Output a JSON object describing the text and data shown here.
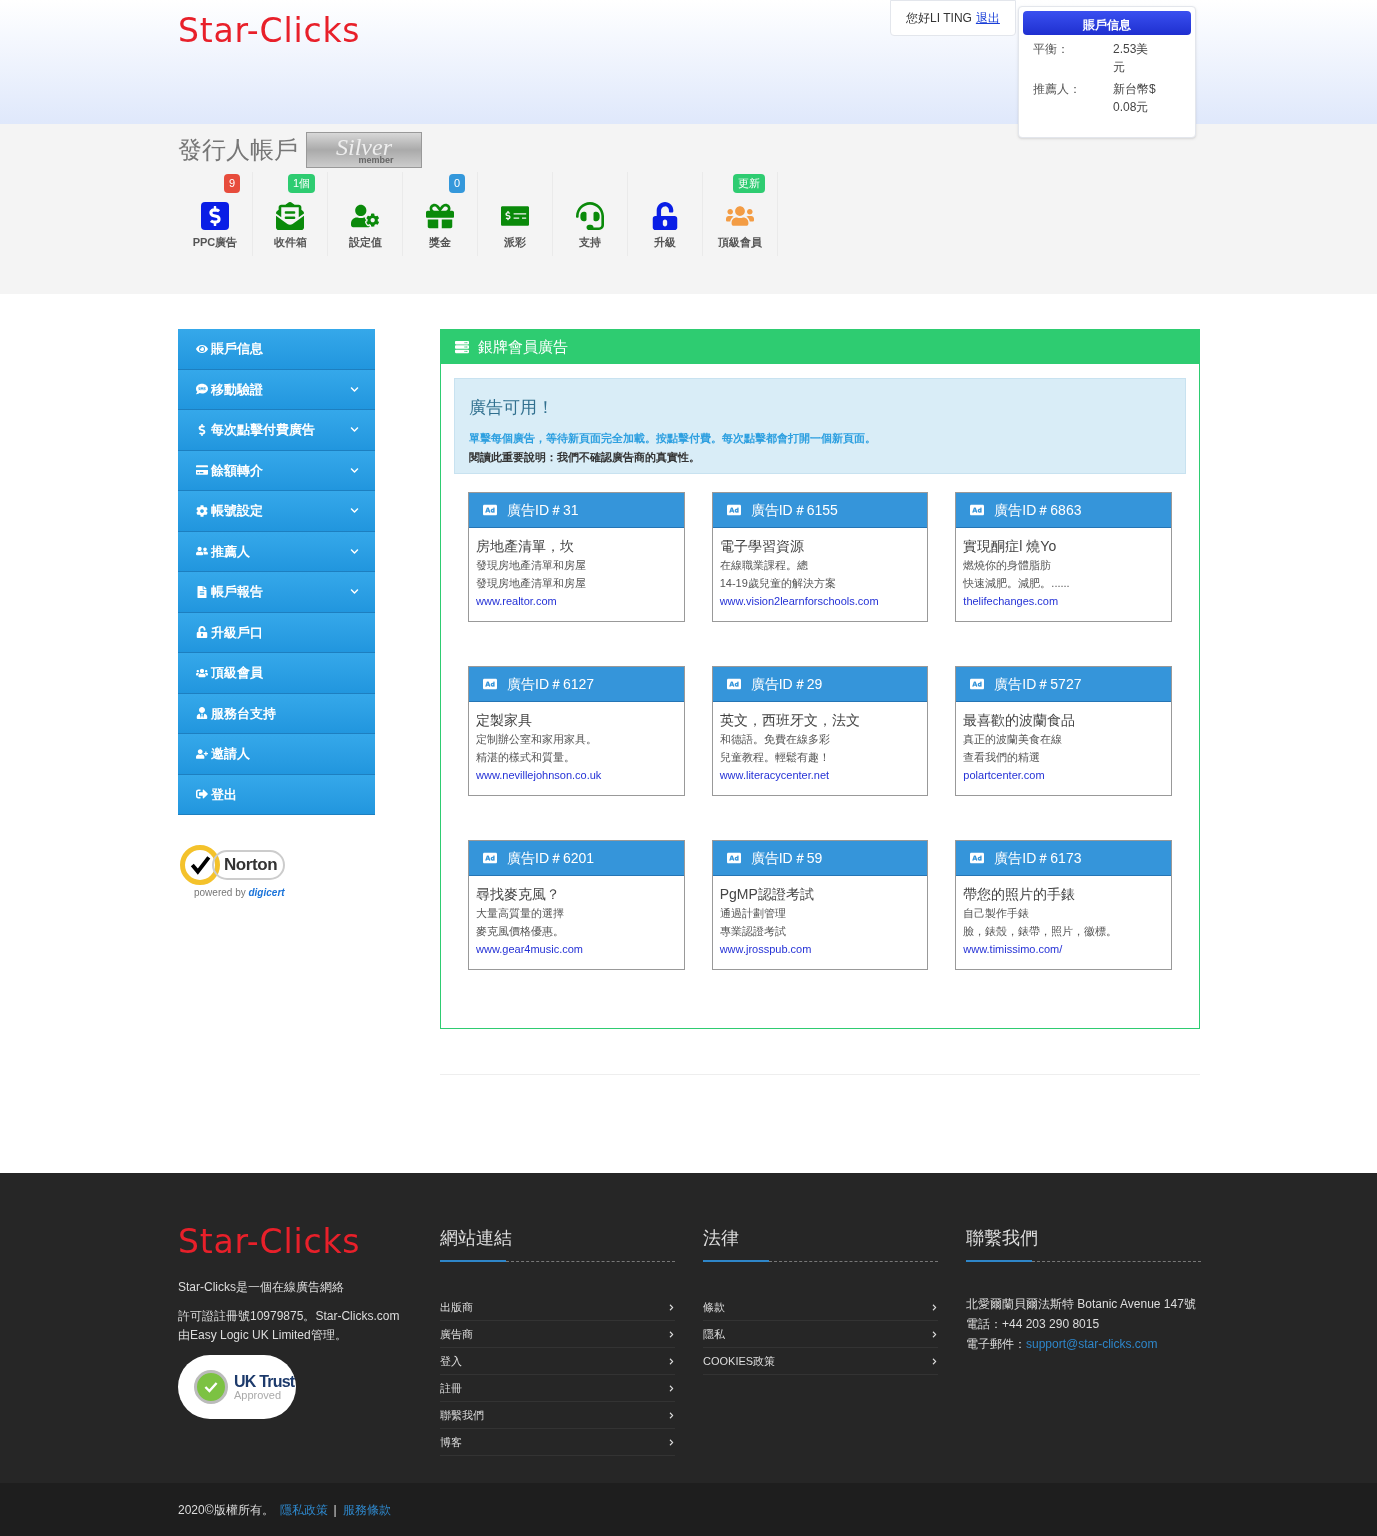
{
  "header": {
    "logo": "Star-Clicks",
    "greeting": "您好LI TING",
    "logout": "退出",
    "account_panel": {
      "title": "賬戶信息",
      "rows": [
        {
          "label": "平衡：",
          "value": "2.53美元"
        },
        {
          "label": "推薦人：",
          "value": "新台幣$ 0.08元"
        }
      ]
    }
  },
  "account_bar": {
    "title": "發行人帳戶",
    "badge": {
      "main": "Silver",
      "sub": "member"
    },
    "tools": [
      {
        "kind": "ppc",
        "label": "PPC廣告",
        "badge": {
          "text": "9",
          "color": "#e74c3c"
        }
      },
      {
        "kind": "inbox",
        "label": "收件箱",
        "badge": {
          "text": "1個",
          "color": "#2ecc71"
        }
      },
      {
        "kind": "settings",
        "label": "設定值"
      },
      {
        "kind": "bonus",
        "label": "獎金",
        "badge": {
          "text": "0",
          "color": "#3498db"
        }
      },
      {
        "kind": "payout",
        "label": "派彩"
      },
      {
        "kind": "support",
        "label": "支持"
      },
      {
        "kind": "upgrade",
        "label": "升級"
      },
      {
        "kind": "top",
        "label": "頂級會員",
        "badge": {
          "text": "更新",
          "color": "#2ecc71"
        }
      }
    ]
  },
  "sidebar": {
    "items": [
      {
        "kind": "eye",
        "label": "賬戶信息",
        "dropdown": false
      },
      {
        "kind": "sms",
        "label": "移動驗證",
        "dropdown": true
      },
      {
        "kind": "dollar",
        "label": "每次點擊付費廣告",
        "dropdown": true
      },
      {
        "kind": "card",
        "label": "餘額轉介",
        "dropdown": true
      },
      {
        "kind": "cog",
        "label": "帳號設定",
        "dropdown": true
      },
      {
        "kind": "users",
        "label": "推薦人",
        "dropdown": true
      },
      {
        "kind": "report",
        "label": "帳戶報告",
        "dropdown": true
      },
      {
        "kind": "unlock",
        "label": "升級戶口",
        "dropdown": false
      },
      {
        "kind": "group",
        "label": "頂級會員",
        "dropdown": false
      },
      {
        "kind": "support",
        "label": "服務台支持",
        "dropdown": false
      },
      {
        "kind": "invite",
        "label": "邀請人",
        "dropdown": false
      },
      {
        "kind": "logout",
        "label": "登出",
        "dropdown": false
      }
    ],
    "norton": {
      "name": "Norton",
      "powered": "powered by",
      "brand": "digicert"
    }
  },
  "panel": {
    "title": "銀牌會員廣告",
    "notice": {
      "heading": "廣告可用！",
      "instruction": "單擊每個廣告，等待新頁面完全加載。按點擊付費。每次點擊都會打開一個新頁面。",
      "disclaimer": "閱讀此重要說明：我們不確認廣告商的真實性。"
    },
    "ads": [
      {
        "id": "廣告ID＃31",
        "title": "房地產清單，坎",
        "line1": "發現房地產清單和房屋",
        "line2": "發現房地產清單和房屋",
        "url": "www.realtor.com"
      },
      {
        "id": "廣告ID＃6155",
        "title": "電子學習資源",
        "line1": "在線職業課程。總",
        "line2": "14-19歲兒童的解決方案",
        "url": "www.vision2learnforschools.com"
      },
      {
        "id": "廣告ID＃6863",
        "title": "實現酮症l 燒Yo",
        "line1": "燃燒你的身體脂肪",
        "line2": "快速減肥。減肥。......",
        "url": "thelifechanges.com"
      },
      {
        "id": "廣告ID＃6127",
        "title": "定製家具",
        "line1": "定制辦公室和家用家具。",
        "line2": "精湛的樣式和質量。",
        "url": "www.nevillejohnson.co.uk"
      },
      {
        "id": "廣告ID＃29",
        "title": "英文，西班牙文，法文",
        "line1": "和德語。免費在線多彩",
        "line2": "兒童教程。輕鬆有趣！",
        "url": "www.literacycenter.net"
      },
      {
        "id": "廣告ID＃5727",
        "title": "最喜歡的波蘭食品",
        "line1": "真正的波蘭美食在線",
        "line2": "查看我們的精選",
        "url": "polartcenter.com"
      },
      {
        "id": "廣告ID＃6201",
        "title": "尋找麥克風？",
        "line1": "大量高質量的選擇",
        "line2": "麥克風價格優惠。",
        "url": "www.gear4music.com"
      },
      {
        "id": "廣告ID＃59",
        "title": "PgMP認證考試",
        "line1": "通過計劃管理",
        "line2": "專業認證考試",
        "url": "www.jrosspub.com"
      },
      {
        "id": "廣告ID＃6173",
        "title": "帶您的照片的手錶",
        "line1": "自己製作手錶",
        "line2": "臉，錶殼，錶帶，照片，徽標。",
        "url": "www.timissimo.com/"
      }
    ]
  },
  "footer": {
    "logo": "Star-Clicks",
    "about": "Star-Clicks是一個在線廣告網絡",
    "license_lines": [
      "許可證註冊號10979875。Star-Clicks.com",
      "由Easy Logic UK Limited管理。"
    ],
    "trust": {
      "name": "UK Trust",
      "sub": "Approved"
    },
    "links": {
      "title": "網站連結",
      "items": [
        "出版商",
        "廣告商",
        "登入",
        "註冊",
        "聯繫我們",
        "博客"
      ]
    },
    "legal": {
      "title": "法律",
      "items": [
        "條款",
        "隱私",
        "COOKIES政策"
      ]
    },
    "contact": {
      "title": "聯繫我們",
      "address": "北愛爾蘭貝爾法斯特 Botanic Avenue 147號",
      "phone": "電話：+44 203 290 8015",
      "email_label": "電子郵件：",
      "email": "support@star-clicks.com"
    },
    "copyright": "2020©版權所有。",
    "privacy": "隱私政策",
    "separator": "|",
    "terms": "服務條款"
  }
}
